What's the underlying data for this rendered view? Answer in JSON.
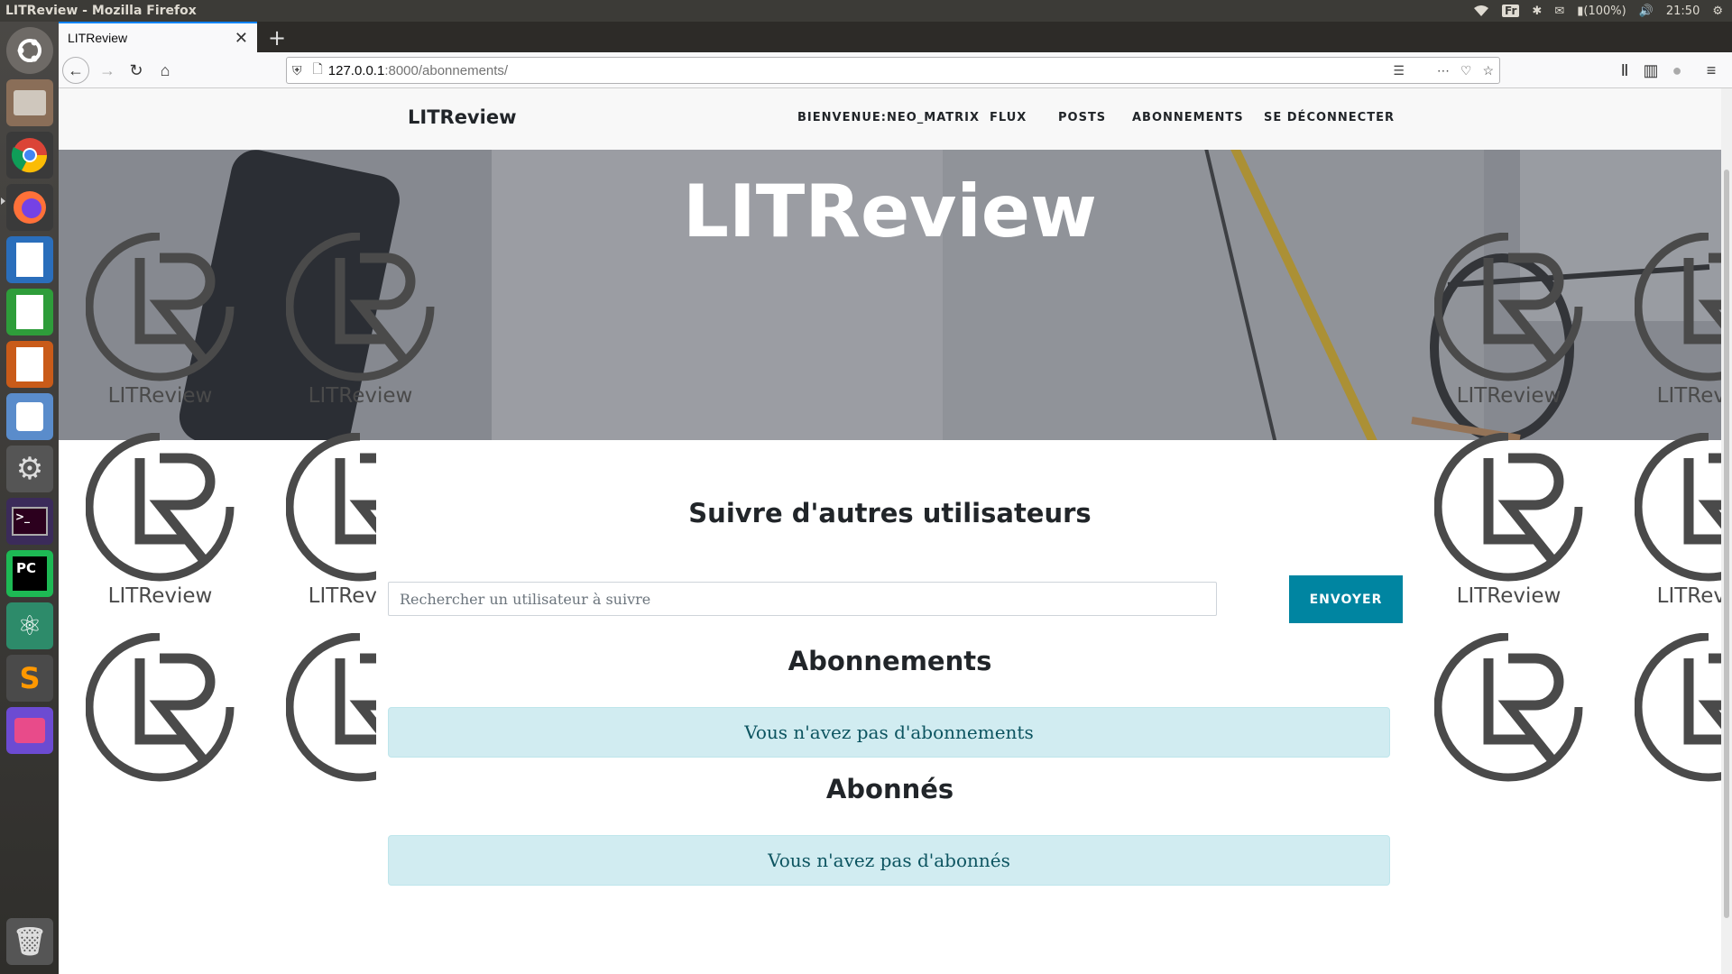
{
  "top_panel": {
    "window_title": "LITReview - Mozilla Firefox",
    "keyboard": "Fr",
    "battery": "(100%)",
    "clock": "21:50"
  },
  "browser": {
    "tab_title": "LITReview",
    "url_host": "127.0.0.1",
    "url_rest": ":8000/abonnements/"
  },
  "site": {
    "brand": "LITReview",
    "nav": [
      "BIENVENUE:NEO_MATRIX",
      "FLUX",
      "POSTS",
      "ABONNEMENTS",
      "SE DÉCONNECTER"
    ],
    "hero_title": "LITReview",
    "logo_word": "LITReview"
  },
  "follow": {
    "title": "Suivre d'autres utilisateurs",
    "placeholder": "Rechercher un utilisateur à suivre",
    "send_label": "ENVOYER"
  },
  "subscriptions": {
    "title": "Abonnements",
    "empty_message": "Vous n'avez pas d'abonnements"
  },
  "followers": {
    "title": "Abonnés",
    "empty_message": "Vous n'avez pas d'abonnés"
  },
  "launcher_icons": [
    "ubuntu-dash-icon",
    "files-icon",
    "chrome-icon",
    "firefox-icon",
    "writer-icon",
    "calc-icon",
    "impress-icon",
    "software-center-icon",
    "settings-icon",
    "terminal-icon",
    "pycharm-icon",
    "atom-icon",
    "sublime-icon",
    "screenshot-icon",
    "trash-icon"
  ]
}
